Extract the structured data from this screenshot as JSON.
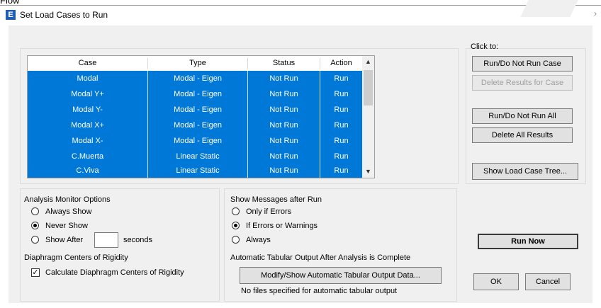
{
  "page": {
    "cut_text": "Flow"
  },
  "window": {
    "title": "Set Load Cases to Run",
    "icon_letter": "E"
  },
  "table": {
    "headers": [
      "Case",
      "Type",
      "Status",
      "Action"
    ],
    "rows": [
      [
        "Modal",
        "Modal - Eigen",
        "Not Run",
        "Run"
      ],
      [
        "Modal Y+",
        "Modal - Eigen",
        "Not Run",
        "Run"
      ],
      [
        "Modal Y-",
        "Modal - Eigen",
        "Not Run",
        "Run"
      ],
      [
        "Modal X+",
        "Modal - Eigen",
        "Not Run",
        "Run"
      ],
      [
        "Modal X-",
        "Modal - Eigen",
        "Not Run",
        "Run"
      ],
      [
        "C.Muerta",
        "Linear Static",
        "Not Run",
        "Run"
      ],
      [
        "C.Viva",
        "Linear Static",
        "Not Run",
        "Run"
      ]
    ],
    "selected_color": "#0078d7"
  },
  "click_to": {
    "label": "Click to:",
    "run_do_not_run_case": "Run/Do Not Run Case",
    "delete_results_for_case": "Delete Results for Case",
    "run_do_not_run_all": "Run/Do Not Run All",
    "delete_all_results": "Delete All Results",
    "show_load_case_tree": "Show Load Case Tree..."
  },
  "analysis_monitor": {
    "title": "Analysis Monitor Options",
    "always_show": "Always Show",
    "never_show": "Never Show",
    "show_after": "Show After",
    "seconds": "seconds",
    "seconds_value": "",
    "selected": "Never Show"
  },
  "messages": {
    "title": "Show Messages after Run",
    "only_if_errors": "Only if Errors",
    "if_errors_or_warnings": "If Errors or Warnings",
    "always": "Always",
    "selected": "If Errors or Warnings"
  },
  "diaphragm": {
    "title": "Diaphragm Centers of Rigidity",
    "calculate": "Calculate Diaphragm Centers of Rigidity",
    "checked": true
  },
  "tabular": {
    "title": "Automatic Tabular Output After Analysis is Complete",
    "button": "Modify/Show Automatic Tabular Output Data...",
    "status": "No files specified for automatic tabular output"
  },
  "actions": {
    "run_now": "Run Now",
    "ok": "OK",
    "cancel": "Cancel"
  }
}
